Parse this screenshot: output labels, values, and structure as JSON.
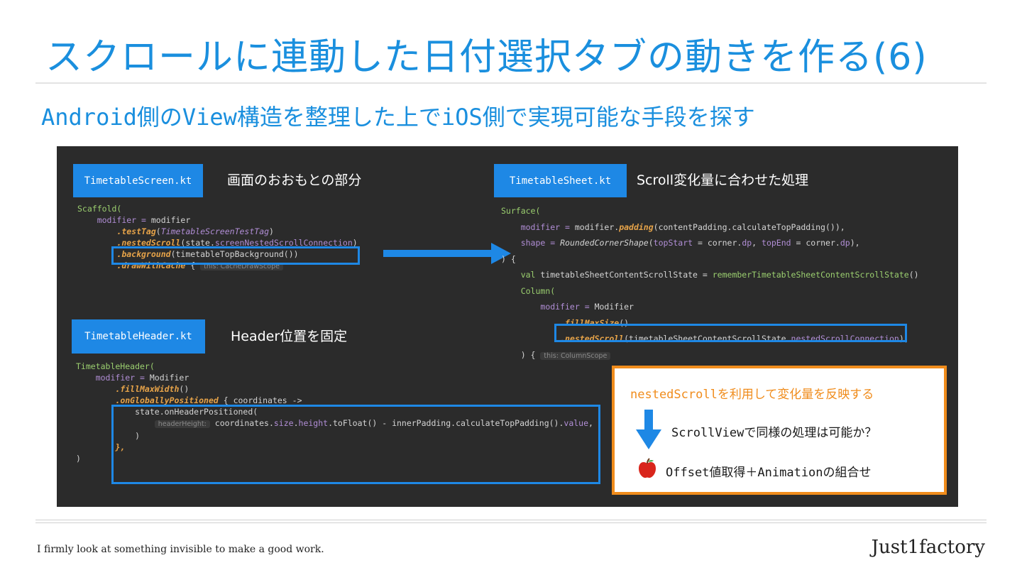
{
  "title": "スクロールに連動した日付選択タブの動きを作る(6)",
  "subtitle": "Android側のView構造を整理した上でiOS側で実現可能な手段を探す",
  "screen": {
    "file": "TimetableScreen.kt",
    "desc": "画面のおおもとの部分",
    "l1": "Scaffold(",
    "modifier_kw": "modifier",
    "eq": " = ",
    "modifier_val": "modifier",
    "testTag_fn": ".testTag",
    "testTag_arg": "TimetableScreenTestTag",
    "nested_fn": ".nestedScroll",
    "nested_state": "state.",
    "nested_arg": "screenNestedScrollConnection",
    "bg_fn": ".background",
    "bg_arg": "(timetableTopBackground())",
    "draw_fn": ".drawWithCache",
    "brace": " { ",
    "draw_hint": "this: CacheDrawScope"
  },
  "header": {
    "file": "TimetableHeader.kt",
    "desc": "Header位置を固定",
    "l1": "TimetableHeader(",
    "modifier_kw": "modifier",
    "eq": " = ",
    "modifier_val": "Modifier",
    "fill_fn": ".fillMaxWidth",
    "fill_tail": "()",
    "ogp_fn": ".onGloballyPositioned",
    "ogp_tail": " { coordinates ->",
    "l5": "state.onHeaderPositioned(",
    "hint": "headerHeight:",
    "coord_pre": " coordinates.",
    "coord_size": "size",
    "coord_dot": ".",
    "coord_height": "height",
    "coord_tail": ".toFloat() - innerPadding.calculateTopPadding().",
    "coord_value": "value",
    "coord_end": ",",
    "l7": ")",
    "l8": "},",
    "l9": ")"
  },
  "sheet": {
    "file": "TimetableSheet.kt",
    "desc": "Scroll変化量に合わせた処理",
    "l1": "Surface(",
    "mod_kw": "modifier",
    "eq": " = ",
    "mod_val": "modifier.",
    "padding_fn": "padding",
    "padding_arg": "(contentPadding.calculateTopPadding()),",
    "shape_kw": "shape",
    "shape_val": "RoundedCornerShape",
    "shape_p1": "(",
    "top_start": "topStart",
    "shape_p2": " = corner.",
    "dp1": "dp",
    "shape_p3": ", ",
    "top_end": "topEnd",
    "shape_p4": " = corner.",
    "dp2": "dp",
    "shape_p5": "),",
    "l4": ") {",
    "val_kw": "val",
    "val_name": " timetableSheetContentScrollState",
    "val_eq": " = ",
    "val_fn": "rememberTimetableSheetContentScrollState",
    "val_end": "()",
    "col": "Column(",
    "col_mod": "modifier",
    "col_eq": " = ",
    "col_val": "Modifier",
    "fms_fn": ".fillMaxSize",
    "fms_tail": "()",
    "ns_fn": ".nestedScroll",
    "ns_arg1": "(timetableSheetContentScrollState.",
    "ns_arg2": "nestedScrollConnection",
    "ns_end": "),",
    "close": ") { ",
    "close_hint": "this: ColumnScope"
  },
  "note": {
    "title": "nestedScrollを利用して変化量を反映する",
    "line1": "ScrollViewで同様の処理は可能か？",
    "line2": "Offset値取得＋Animationの組合せ"
  },
  "footer": {
    "tagline": "I firmly look at something invisible to make a good work.",
    "brand": "Just1factory"
  },
  "colors": {
    "accent": "#1a8fde",
    "highlight": "#1e88e5",
    "note_border": "#f08c1c",
    "panel_bg": "#2b2b2b"
  }
}
